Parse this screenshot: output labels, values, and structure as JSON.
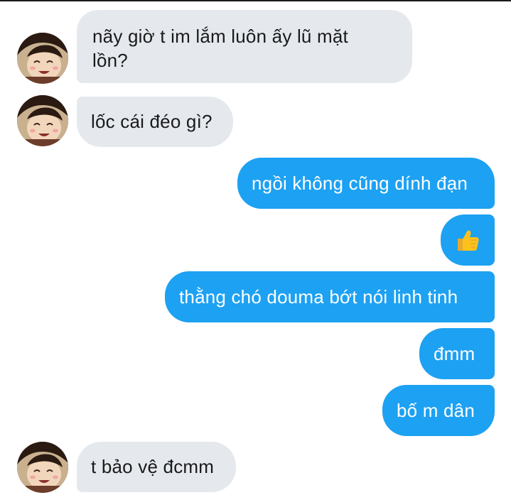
{
  "conversation": {
    "messages": [
      {
        "side": "incoming",
        "lines": [
          "nãy giờ t im lắm luôn ấy lũ mặt",
          "lồn?"
        ]
      },
      {
        "side": "incoming",
        "text": "lốc cái đéo gì?"
      },
      {
        "side": "outgoing",
        "text": "ngồi không cũng dính đạn"
      },
      {
        "side": "outgoing",
        "emoji": "thumbs-up-icon"
      },
      {
        "side": "outgoing",
        "text": "thằng chó douma bớt nói linh tinh"
      },
      {
        "side": "outgoing",
        "text": "đmm"
      },
      {
        "side": "outgoing",
        "text": "bố m dân"
      },
      {
        "side": "incoming",
        "text": "t bảo vệ đcmm"
      }
    ]
  },
  "colors": {
    "incoming_bubble": "#e5e9ee",
    "outgoing_bubble": "#1da1f2",
    "incoming_text": "#1a1a1a",
    "outgoing_text": "#ffffff"
  }
}
